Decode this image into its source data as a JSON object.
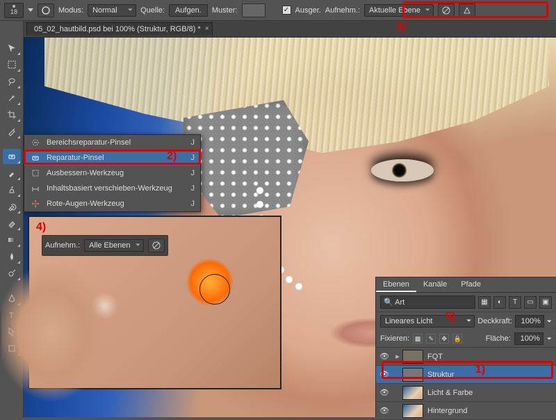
{
  "options_bar": {
    "brush_size": "18",
    "mode_label": "Modus:",
    "mode_value": "Normal",
    "source_label": "Quelle:",
    "source_btn": "Aufgen.",
    "pattern_label": "Muster:",
    "aligned_label": "Ausger.",
    "sample_label": "Aufnehm.:",
    "sample_value": "Aktuelle Ebene"
  },
  "document_tab": "05_02_hautbild.psd bei 100% (Struktur, RGB/8) *",
  "tool_flyout": {
    "items": [
      {
        "label": "Bereichsreparatur-Pinsel",
        "key": "J",
        "selected": false
      },
      {
        "label": "Reparatur-Pinsel",
        "key": "J",
        "selected": true
      },
      {
        "label": "Ausbessern-Werkzeug",
        "key": "J",
        "selected": false
      },
      {
        "label": "Inhaltsbasiert verschieben-Werkzeug",
        "key": "J",
        "selected": false
      },
      {
        "label": "Rote-Augen-Werkzeug",
        "key": "J",
        "selected": false
      }
    ]
  },
  "inset": {
    "sample_label": "Aufnehm.:",
    "sample_value": "Alle Ebenen"
  },
  "layers_panel": {
    "tabs": [
      "Ebenen",
      "Kanäle",
      "Pfade"
    ],
    "filter_value": "Art",
    "blend_value": "Lineares Licht",
    "opacity_label": "Deckkraft:",
    "opacity_value": "100%",
    "lock_label": "Fixieren:",
    "fill_label": "Fläche:",
    "fill_value": "100%",
    "layers": [
      {
        "name": "FQT",
        "type": "group",
        "visible": true,
        "selected": false
      },
      {
        "name": "Struktur",
        "type": "pixel",
        "visible": true,
        "selected": true
      },
      {
        "name": "Licht & Farbe",
        "type": "pixel",
        "visible": true,
        "selected": false
      },
      {
        "name": "Hintergrund",
        "type": "pixel",
        "visible": true,
        "selected": false
      }
    ]
  },
  "annotations": {
    "a1": "1)",
    "a2": "2)",
    "a3": "3)",
    "a4": "4)",
    "a5": "5)"
  }
}
